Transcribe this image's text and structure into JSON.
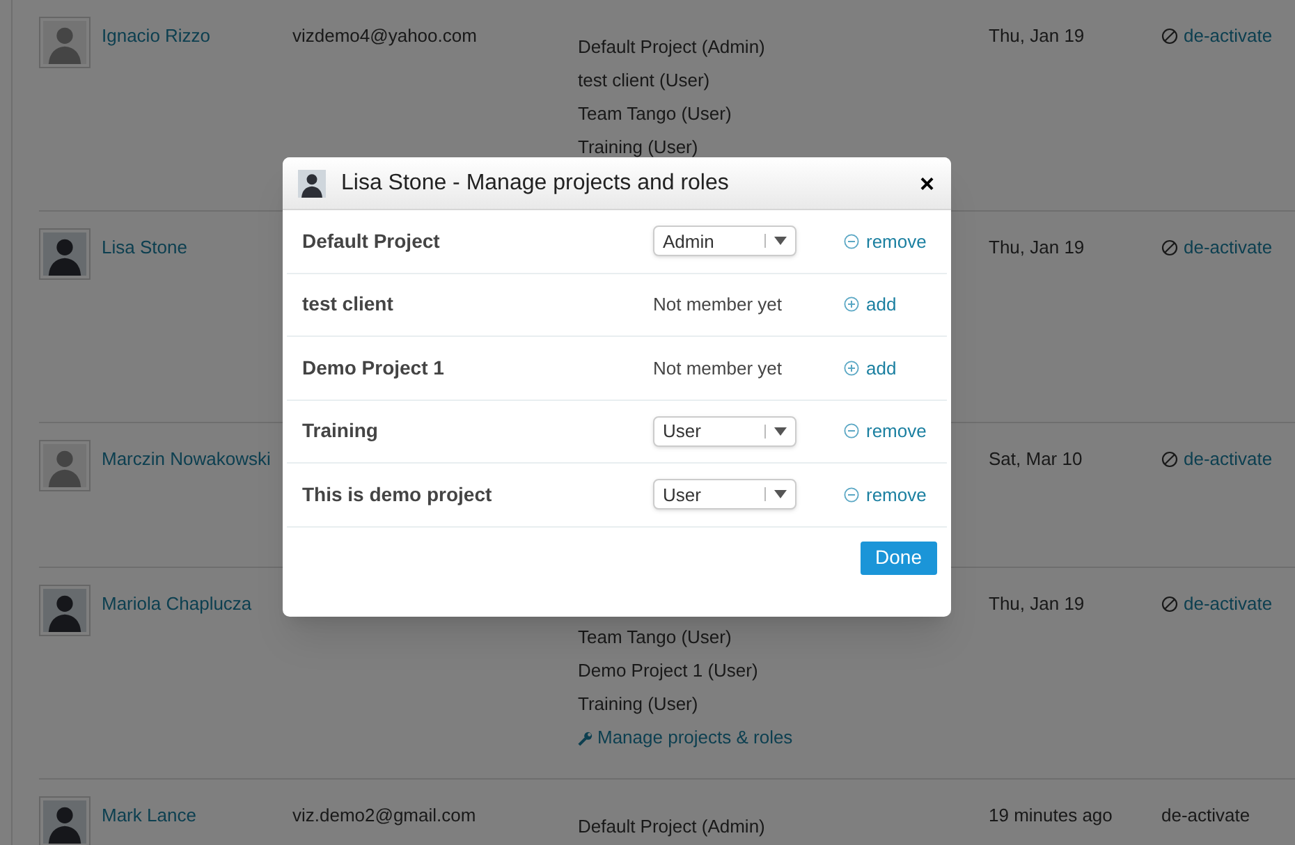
{
  "users": [
    {
      "name": "Ignacio Rizzo",
      "avatar": {
        "kind": "default"
      },
      "email": "vizdemo4@yahoo.com",
      "projects": [
        "Default Project (Admin)",
        "test client (User)",
        "Team Tango (User)",
        "Training (User)"
      ],
      "last_seen": "Thu, Jan 19",
      "action": {
        "label": "de-activate",
        "disabled": false
      }
    },
    {
      "name": "Lisa Stone",
      "avatar": {
        "kind": "photo"
      },
      "last_seen": "Thu, Jan 19",
      "action": {
        "label": "de-activate",
        "disabled": false
      }
    },
    {
      "name": "Marczin Nowakowski",
      "avatar": {
        "kind": "default"
      },
      "last_seen": "Sat, Mar 10",
      "action": {
        "label": "de-activate",
        "disabled": false
      }
    },
    {
      "name": "Mariola Chaplucza",
      "avatar": {
        "kind": "photo"
      },
      "projects": [
        "Team Tango (User)",
        "Demo Project 1 (User)",
        "Training (User)"
      ],
      "manage_link": "Manage projects & roles",
      "last_seen": "Thu, Jan 19",
      "action": {
        "label": "de-activate",
        "disabled": false
      }
    },
    {
      "name": "Mark Lance",
      "avatar": {
        "kind": "photo"
      },
      "email": "viz.demo2@gmail.com",
      "projects": [
        "Default Project (Admin)"
      ],
      "last_seen": "19 minutes ago",
      "action": {
        "label": "de-activate",
        "disabled": true
      }
    }
  ],
  "dialog": {
    "title": "Lisa Stone - Manage projects and roles",
    "close": "×",
    "rows": [
      {
        "project": "Default Project",
        "kind": "member",
        "role": "Admin",
        "action": "remove"
      },
      {
        "project": "test client",
        "kind": "nonmember",
        "status": "Not member yet",
        "action": "add"
      },
      {
        "project": "Demo Project 1",
        "kind": "nonmember",
        "status": "Not member yet",
        "action": "add"
      },
      {
        "project": "Training",
        "kind": "member",
        "role": "User",
        "action": "remove"
      },
      {
        "project": "This is demo project",
        "kind": "member",
        "role": "User",
        "action": "remove"
      }
    ],
    "done": "Done"
  }
}
